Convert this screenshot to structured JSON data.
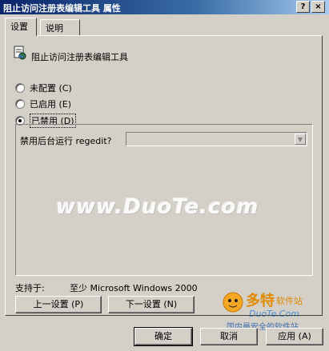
{
  "window": {
    "title": "阻止访问注册表编辑工具 属性",
    "help_button": "?",
    "close_button": "×"
  },
  "tabs": [
    {
      "label": "设置",
      "active": true
    },
    {
      "label": "说明",
      "active": false
    }
  ],
  "policy": {
    "name": "阻止访问注册表编辑工具",
    "icon": "policy-setting-icon"
  },
  "options": [
    {
      "label": "未配置 (C)",
      "checked": false
    },
    {
      "label": "已启用 (E)",
      "checked": false
    },
    {
      "label": "已禁用 (D)",
      "checked": true
    }
  ],
  "option_box": {
    "label": "禁用后台运行 regedit?",
    "combo_value": ""
  },
  "watermark": "www.DuoTe.com",
  "support": {
    "label": "支持于:",
    "value": "至少 Microsoft Windows 2000"
  },
  "nav_buttons": {
    "prev": "上一设置 (P)",
    "next": "下一设置 (N)"
  },
  "dialog_buttons": {
    "ok": "确定",
    "cancel": "取消",
    "apply": "应用 (A)"
  },
  "logo": {
    "brand": "多特",
    "brand_sub": "软件站",
    "url": "DuoTe.Com",
    "slogan": "国内最安全的软件站"
  }
}
